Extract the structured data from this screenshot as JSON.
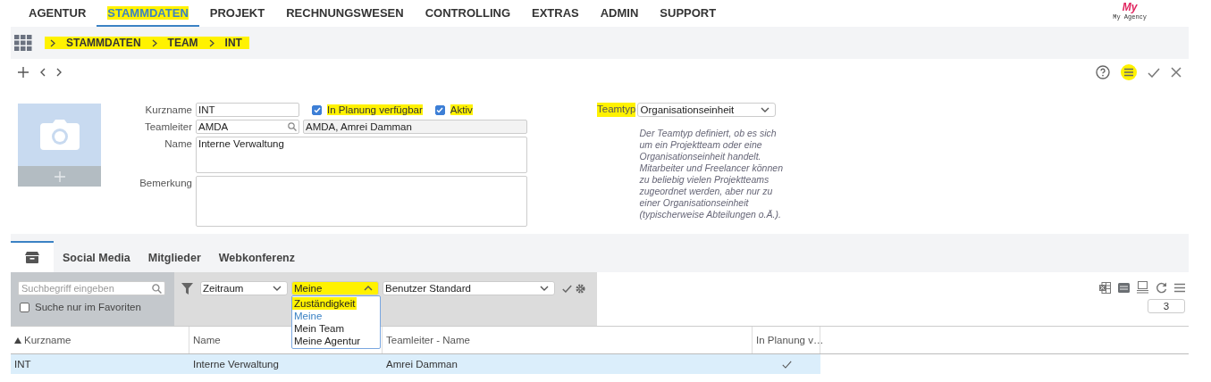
{
  "top_nav": {
    "items": [
      {
        "label": "AGENTUR",
        "selected": false,
        "highlighted": false
      },
      {
        "label": "STAMMDATEN",
        "selected": true,
        "highlighted": true
      },
      {
        "label": "PROJEKT",
        "selected": false,
        "highlighted": false
      },
      {
        "label": "RECHNUNGSWESEN",
        "selected": false,
        "highlighted": false
      },
      {
        "label": "CONTROLLING",
        "selected": false,
        "highlighted": false
      },
      {
        "label": "EXTRAS",
        "selected": false,
        "highlighted": false
      },
      {
        "label": "ADMIN",
        "selected": false,
        "highlighted": false
      },
      {
        "label": "SUPPORT",
        "selected": false,
        "highlighted": false
      }
    ]
  },
  "logo": {
    "mark": "My",
    "name": "My Agency"
  },
  "breadcrumb": {
    "highlighted": true,
    "items": [
      "STAMMDATEN",
      "TEAM",
      "INT"
    ]
  },
  "toolbar": {
    "menu_highlighted": true
  },
  "form": {
    "kurzname": {
      "label": "Kurzname",
      "value": "INT"
    },
    "checkboxes": [
      {
        "label": "In Planung verfügbar",
        "checked": true,
        "highlighted": true
      },
      {
        "label": "Aktiv",
        "checked": true,
        "highlighted": true
      }
    ],
    "teamleiter": {
      "label": "Teamleiter",
      "value": "AMDA",
      "display": "AMDA, Amrei Damman"
    },
    "name": {
      "label": "Name",
      "value": "Interne Verwaltung"
    },
    "bemerkung": {
      "label": "Bemerkung"
    },
    "teamtyp": {
      "label": "Teamtyp",
      "value": "Organisationseinheit",
      "highlighted": true,
      "help": "Der Teamtyp definiert, ob es sich um ein Projektteam oder eine Organisationseinheit handelt. Mitarbeiter und Freelancer können zu beliebig vielen Projektteams zugeordnet werden, aber nur zu einer Organisationseinheit (typischerweise Abteilungen o.Ä.)."
    }
  },
  "tabs": [
    {
      "kind": "icon",
      "selected": true
    },
    {
      "kind": "text",
      "label": "Social Media",
      "selected": false
    },
    {
      "kind": "text",
      "label": "Mitglieder",
      "selected": false
    },
    {
      "kind": "text",
      "label": "Webkonferenz",
      "selected": false
    }
  ],
  "filter": {
    "search_placeholder": "Suchbegriff eingeben",
    "favorites": {
      "label": "Suche nur im Favoriten",
      "checked": false
    },
    "period": "Zeitraum",
    "scope": {
      "value": "Meine",
      "expanded": true,
      "highlighted": true,
      "options": [
        {
          "label": "Zuständigkeit",
          "selected": false,
          "highlighted": true
        },
        {
          "label": "Meine",
          "selected": true,
          "highlighted": false
        },
        {
          "label": "Mein Team",
          "selected": false,
          "highlighted": false
        },
        {
          "label": "Meine Agentur",
          "selected": false,
          "highlighted": false
        }
      ]
    },
    "view": "Benutzer Standard",
    "page_size": "3"
  },
  "table": {
    "columns": [
      {
        "label": "Kurzname",
        "sorted": true
      },
      {
        "label": "Name",
        "sorted": false
      },
      {
        "label": "Teamleiter - Name",
        "sorted": false
      },
      {
        "label": "In Planung v…",
        "sorted": false
      }
    ],
    "rows": [
      {
        "cells": [
          "INT",
          "Interne Verwaltung",
          "Amrei Damman"
        ],
        "in_planung": true,
        "selected": true
      }
    ]
  }
}
